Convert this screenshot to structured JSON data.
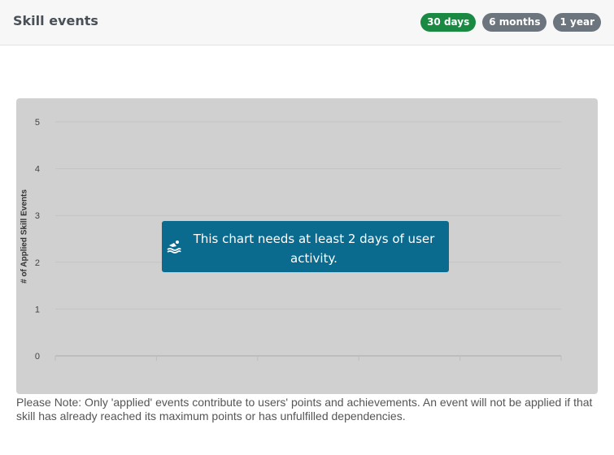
{
  "header": {
    "title": "Skill events",
    "ranges": [
      {
        "label": "30 days",
        "active": true
      },
      {
        "label": "6 months",
        "active": false
      },
      {
        "label": "1 year",
        "active": false
      }
    ]
  },
  "chart_data": {
    "type": "line",
    "title": "",
    "ylabel": "# of Applied Skill Events",
    "xlabel": "",
    "ylim": [
      0,
      5
    ],
    "yticks": [
      0,
      1,
      2,
      3,
      4,
      5
    ],
    "grid": true,
    "series": []
  },
  "notice": {
    "icon": "swimmer-icon",
    "text": "This chart needs at least 2 days of user activity."
  },
  "footnote": "Please Note: Only 'applied' events contribute to users' points and achievements. An event will not be applied if that skill has already reached its maximum points or has unfulfilled dependencies.",
  "colors": {
    "active_range": "#1a8a43",
    "inactive_range": "#6c757d",
    "notice_bg": "#0a6b8f",
    "chart_bg": "#d0d0d0"
  }
}
